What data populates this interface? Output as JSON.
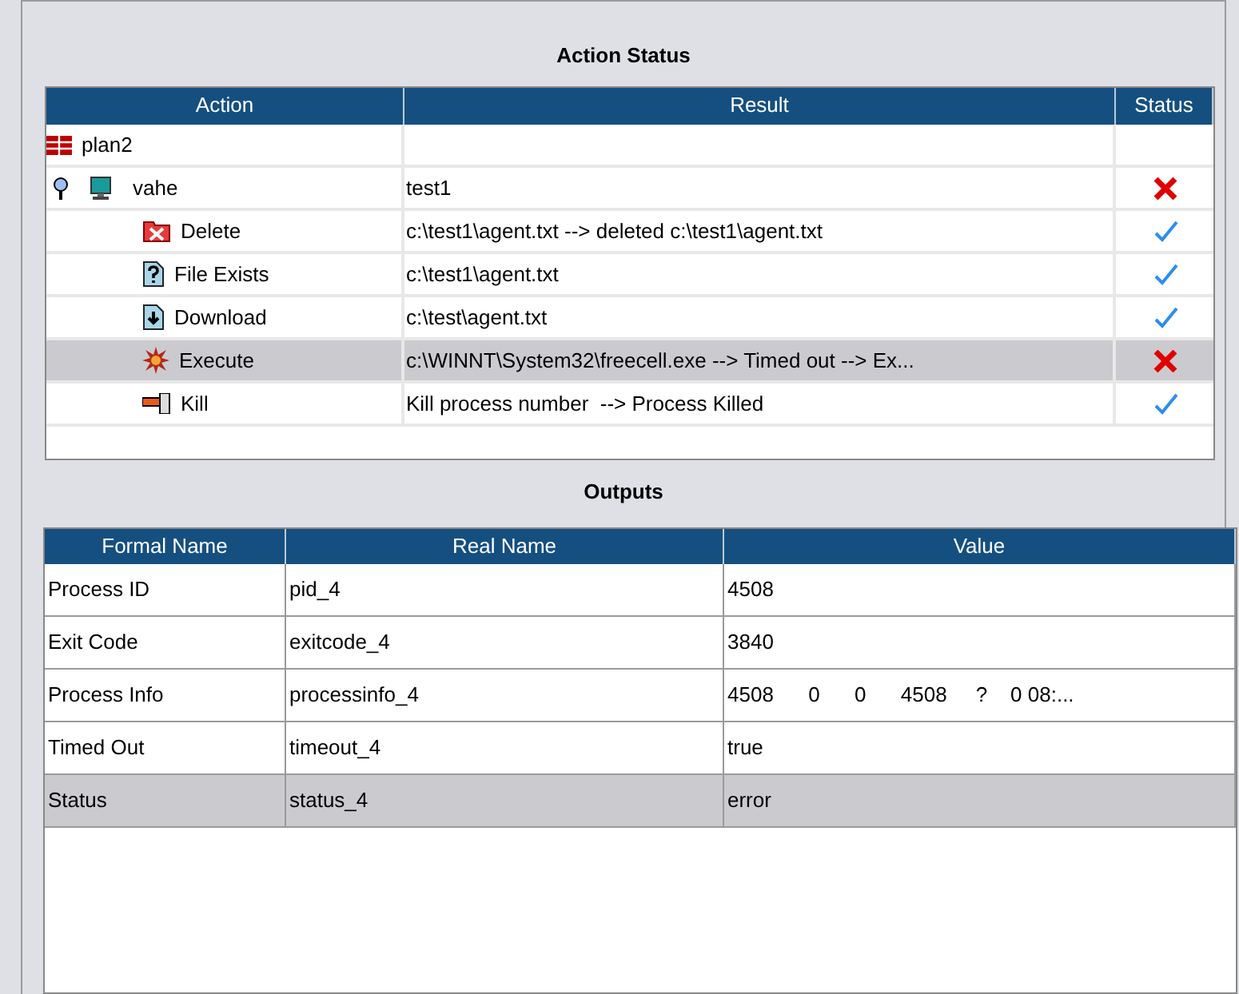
{
  "action_status": {
    "title": "Action Status",
    "columns": [
      "Action",
      "Result",
      "Status"
    ],
    "tree": [
      {
        "label": "plan2",
        "kind": "plan",
        "selected": false,
        "children": [
          {
            "label": "vahe",
            "kind": "host",
            "result": "test1",
            "passed": false,
            "selected": false,
            "children": [
              {
                "label": "Delete",
                "kind": "delete",
                "result": "c:\\test1\\agent.txt --> deleted c:\\test1\\agent.txt",
                "passed": true,
                "selected": false
              },
              {
                "label": "File Exists",
                "kind": "file_exists",
                "result": "c:\\test1\\agent.txt",
                "passed": true,
                "selected": false
              },
              {
                "label": "Download",
                "kind": "download",
                "result": "c:\\test\\agent.txt",
                "passed": true,
                "selected": false
              },
              {
                "label": "Execute",
                "kind": "execute",
                "result": "c:\\WINNT\\System32\\freecell.exe --> Timed out --> Ex...",
                "passed": false,
                "selected": true
              },
              {
                "label": "Kill",
                "kind": "kill",
                "result": "Kill process number  --> Process Killed",
                "passed": true,
                "selected": false
              }
            ]
          }
        ]
      }
    ]
  },
  "outputs": {
    "title": "Outputs",
    "columns": [
      "Formal Name",
      "Real Name",
      "Value"
    ],
    "rows": [
      {
        "cells": [
          "Process ID",
          "pid_4",
          "4508"
        ],
        "selected": false
      },
      {
        "cells": [
          "Exit Code",
          "exitcode_4",
          "3840"
        ],
        "selected": false
      },
      {
        "cells": [
          "Process Info",
          "processinfo_4",
          "4508      0      0      4508     ?    0 08:..."
        ],
        "selected": false
      },
      {
        "cells": [
          "Timed Out",
          "timeout_4",
          "true"
        ],
        "selected": false
      },
      {
        "cells": [
          "Status",
          "status_4",
          "error"
        ],
        "selected": true
      }
    ]
  }
}
